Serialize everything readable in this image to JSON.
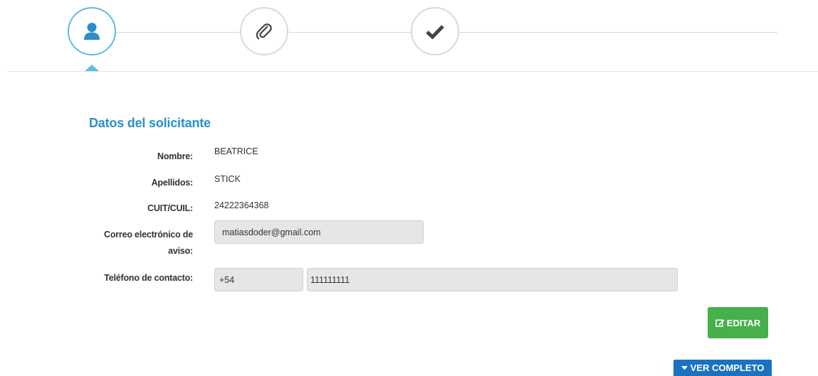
{
  "stepper": {
    "steps": [
      {
        "icon": "user-icon",
        "state": "active"
      },
      {
        "icon": "paperclip-icon",
        "state": "pending"
      },
      {
        "icon": "checkmark-icon",
        "state": "pending"
      }
    ],
    "colors": {
      "active": "#5bbde0",
      "inactive": "#d9d9d9",
      "icon_active": "#2a8fc9",
      "icon_inactive": "#444444"
    }
  },
  "section": {
    "title": "Datos del solicitante",
    "title_color": "#2a8fc9"
  },
  "fields": {
    "nombre": {
      "label": "Nombre:",
      "value": "BEATRICE"
    },
    "apellidos": {
      "label": "Apellidos:",
      "value": "STICK"
    },
    "cuit": {
      "label": "CUIT/CUIL:",
      "value": "24222364368"
    },
    "correo": {
      "label_line1": "Correo electrónico de",
      "label_line2": "aviso:",
      "value": "matiasdoder@gmail.com"
    },
    "telefono": {
      "label": "Teléfono de contacto:",
      "prefix": "+54",
      "number": "111111111"
    }
  },
  "buttons": {
    "edit": {
      "label": "EDITAR",
      "icon": "edit-icon",
      "color": "#46b04a"
    },
    "full": {
      "label": "VER COMPLETO",
      "icon": "caret-down-icon",
      "color": "#1a72c0"
    }
  }
}
